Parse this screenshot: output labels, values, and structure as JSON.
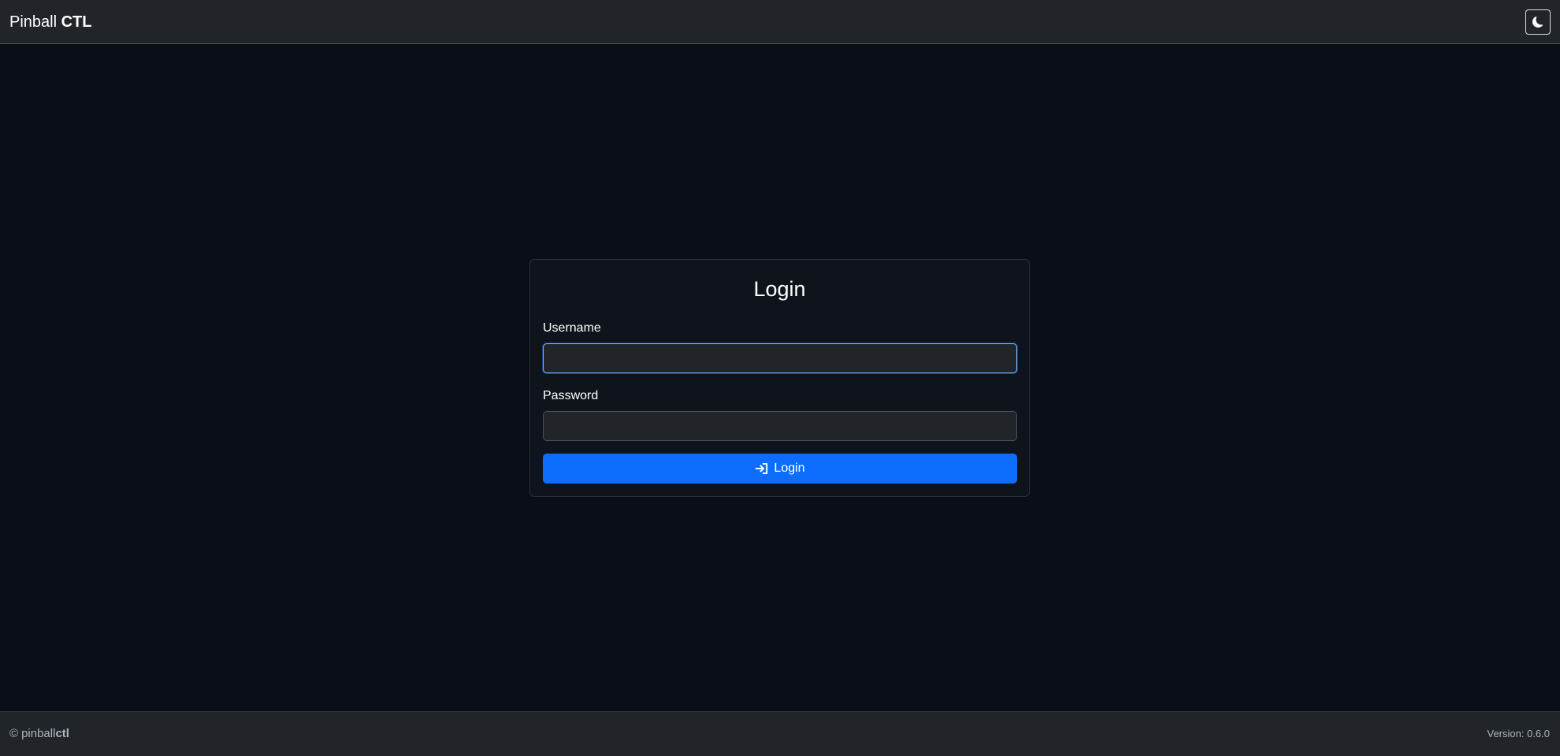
{
  "navbar": {
    "brand_prefix": "Pinball",
    "brand_strong": "CTL",
    "theme_toggle_icon": "moon-icon"
  },
  "login": {
    "title": "Login",
    "username_label": "Username",
    "username_value": "",
    "password_label": "Password",
    "password_value": "",
    "button_label": "Login",
    "button_icon": "sign-in-icon"
  },
  "footer": {
    "copyright_symbol": "©",
    "brand_prefix": "pinball",
    "brand_strong": "ctl",
    "version": "Version: 0.6.0"
  },
  "colors": {
    "background": "#0a0e16",
    "navbar": "#212529",
    "card": "#0f141c",
    "input": "#212529",
    "primary": "#0d6efd",
    "focus_border": "#86b7fe"
  }
}
